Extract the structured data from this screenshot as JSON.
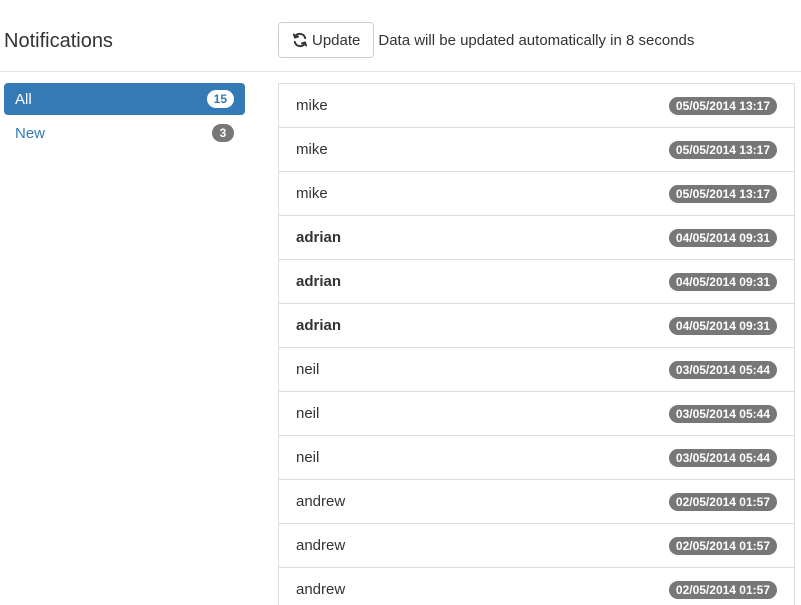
{
  "header": {
    "title": "Notifications",
    "update_label": "Update",
    "status_text": "Data will be updated automatically in 8 seconds"
  },
  "sidebar": {
    "items": [
      {
        "label": "All",
        "count": "15",
        "active": true
      },
      {
        "label": "New",
        "count": "3",
        "active": false
      }
    ]
  },
  "notifications": [
    {
      "name": "mike",
      "time": "05/05/2014 13:17",
      "unread": false
    },
    {
      "name": "mike",
      "time": "05/05/2014 13:17",
      "unread": false
    },
    {
      "name": "mike",
      "time": "05/05/2014 13:17",
      "unread": false
    },
    {
      "name": "adrian",
      "time": "04/05/2014 09:31",
      "unread": true
    },
    {
      "name": "adrian",
      "time": "04/05/2014 09:31",
      "unread": true
    },
    {
      "name": "adrian",
      "time": "04/05/2014 09:31",
      "unread": true
    },
    {
      "name": "neil",
      "time": "03/05/2014 05:44",
      "unread": false
    },
    {
      "name": "neil",
      "time": "03/05/2014 05:44",
      "unread": false
    },
    {
      "name": "neil",
      "time": "03/05/2014 05:44",
      "unread": false
    },
    {
      "name": "andrew",
      "time": "02/05/2014 01:57",
      "unread": false
    },
    {
      "name": "andrew",
      "time": "02/05/2014 01:57",
      "unread": false
    },
    {
      "name": "andrew",
      "time": "02/05/2014 01:57",
      "unread": false
    }
  ],
  "icons": {
    "update": "refresh-icon"
  },
  "colors": {
    "primary": "#337ab7",
    "badge": "#777777"
  }
}
